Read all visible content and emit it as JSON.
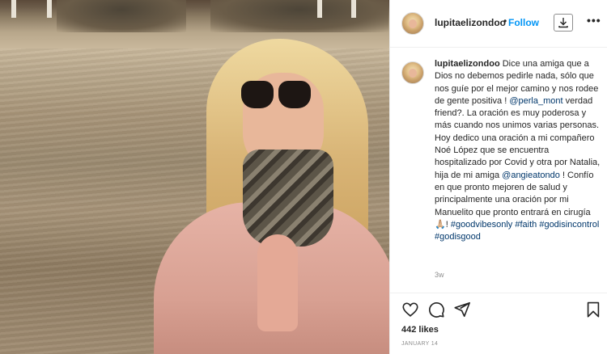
{
  "post": {
    "username": "lupitaelizondoo",
    "dot": "•",
    "follow_label": "Follow",
    "more_label": "•••",
    "caption": {
      "username": "lupitaelizondoo",
      "part1": "Dice una amiga que a Dios no debemos pedirle nada, sólo que nos guíe por el mejor camino y nos rodee de gente positiva ! ",
      "mention1": "@perla_mont",
      "part2": " verdad friend?. La oración es muy poderosa y más cuando nos unimos varias personas. Hoy dedico una oración a mi compañero Noé López que se encuentra hospitalizado por Covid y otra por Natalia, hija de mi amiga ",
      "mention2": "@angieatondo",
      "part3": " ! Confío en que pronto mejoren de salud y principalmente una oración por mi Manuelito que pronto entrará en cirugía ",
      "emoji": "🙏🏼",
      "part4": "! ",
      "tag1": "#goodvibesonly",
      "tag2": "#faith",
      "tag3": "#godisincontrol",
      "tag4": "#godisgood"
    },
    "comment_time": "3w",
    "likes": "442 likes",
    "date": "JANUARY 14"
  },
  "icons": {
    "download": "download-icon",
    "heart": "heart-icon",
    "comment": "comment-icon",
    "share": "share-icon",
    "save": "bookmark-icon"
  },
  "colors": {
    "accent": "#0095f6",
    "mention": "#00376b",
    "text": "#262626",
    "muted": "#8e8e8e"
  }
}
